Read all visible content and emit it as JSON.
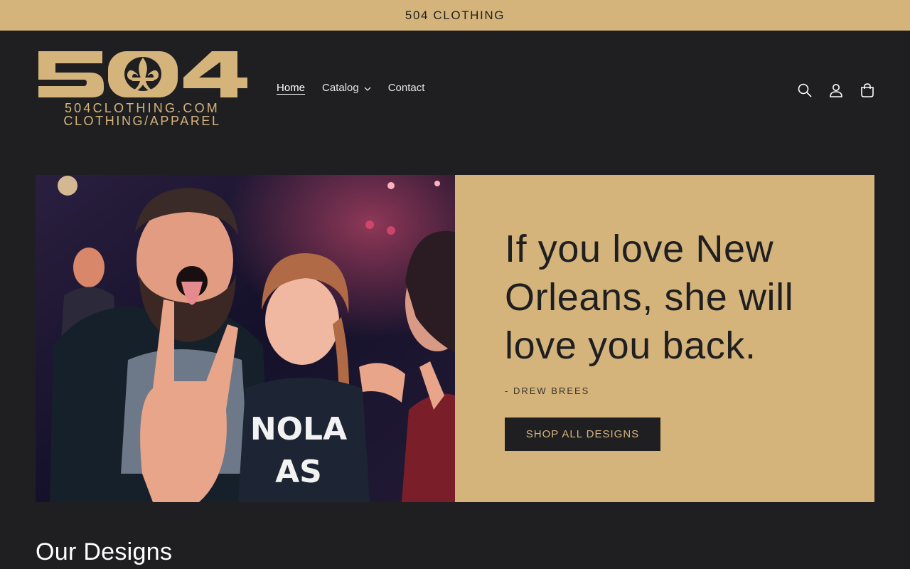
{
  "announcement": {
    "text": "504 CLOTHING"
  },
  "logo": {
    "numerals": "504",
    "line1": "504CLOTHING.COM",
    "line2": "CLOTHING/APPAREL",
    "color": "#d5b47c"
  },
  "nav": {
    "items": [
      {
        "label": "Home",
        "active": true
      },
      {
        "label": "Catalog",
        "has_dropdown": true
      },
      {
        "label": "Contact"
      }
    ]
  },
  "header_icons": [
    "search-icon",
    "account-icon",
    "cart-icon"
  ],
  "hero": {
    "quote": "If you love New Orleans, she will love you back.",
    "author": "- DREW BREES",
    "cta_label": "SHOP ALL DESIGNS",
    "shirt_text_line1": "NOLA",
    "shirt_text_line2": "AS",
    "panel_color": "#d5b47c"
  },
  "section": {
    "title": "Our Designs"
  },
  "colors": {
    "background": "#1f1f21",
    "accent": "#d5b47c",
    "text_dark": "#1f1f21"
  }
}
